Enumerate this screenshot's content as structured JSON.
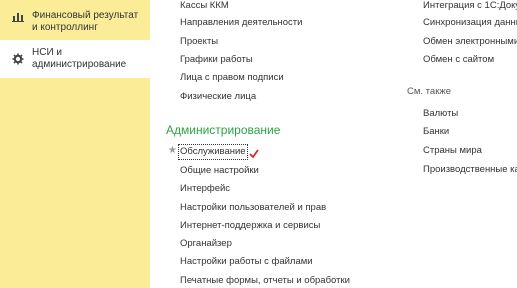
{
  "sidebar": {
    "items": [
      {
        "label": "Финансовый результат и контроллинг",
        "icon": "bar-chart-icon"
      },
      {
        "label": "НСИ и администрирование",
        "icon": "gear-icon"
      }
    ]
  },
  "col1_top": [
    "Кассы ККМ",
    "Направления деятельности",
    "Проекты",
    "Графики работы",
    "Лица с правом подписи",
    "Физические лица"
  ],
  "admin": {
    "title": "Администрирование",
    "items": [
      "Обслуживание",
      "Общие настройки",
      "Интерфейс",
      "Настройки пользователей и прав",
      "Интернет-поддержка и сервисы",
      "Органайзер",
      "Настройки работы с файлами",
      "Печатные формы, отчеты и обработки"
    ]
  },
  "col2_top": [
    "Интеграция с 1С:Доку",
    "Синхронизация данны",
    "Обмен электронными",
    "Обмен с сайтом"
  ],
  "see_also": {
    "title": "См. также",
    "items": [
      "Валюты",
      "Банки",
      "Страны мира",
      "Производственные ка"
    ]
  },
  "colors": {
    "sidebar": "#fbec98",
    "section_title": "#2ea343",
    "checkmark": "#e0262b"
  }
}
